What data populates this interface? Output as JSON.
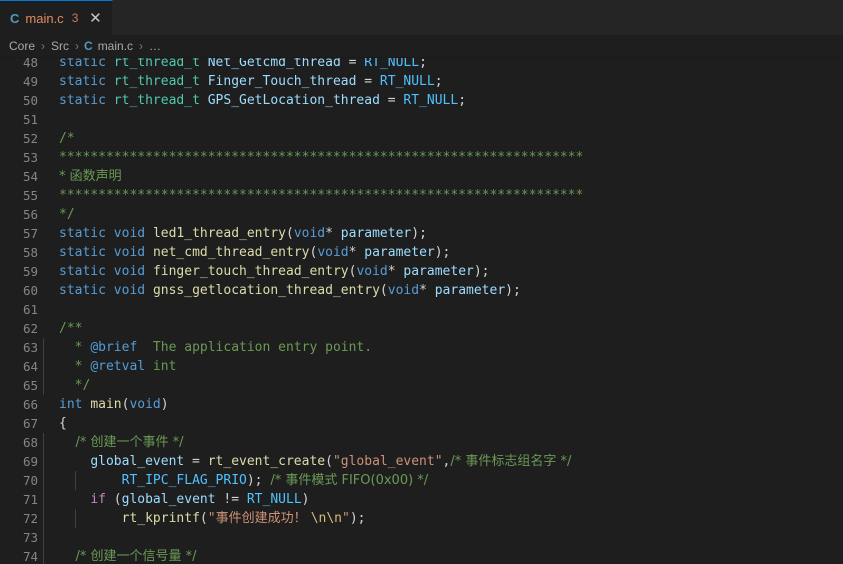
{
  "window": {
    "theme": "dark-plus",
    "background": "#1e1e1e",
    "tabbar_background": "#252526",
    "accent": "#0078d4"
  },
  "tabbar": {
    "tabs": [
      {
        "icon": "c-file-icon",
        "icon_label": "C",
        "label": "main.c",
        "badge": "3",
        "close_label": "✕",
        "active": true
      }
    ]
  },
  "breadcrumb": {
    "items": [
      {
        "label": "Core",
        "icon": null
      },
      {
        "label": "Src",
        "icon": null
      },
      {
        "label": "main.c",
        "icon": "c-file-icon",
        "icon_label": "C"
      },
      {
        "label": "…",
        "icon": null
      }
    ],
    "separator": "›"
  },
  "editor": {
    "language": "c",
    "first_visible_line": 48,
    "last_visible_line": 74,
    "lines": [
      {
        "n": "48",
        "text": "static rt_thread_t Net_Getcmd_thread = RT_NULL;"
      },
      {
        "n": "49",
        "text": "static rt_thread_t Finger_Touch_thread = RT_NULL;"
      },
      {
        "n": "50",
        "text": "static rt_thread_t GPS_GetLocation_thread = RT_NULL;"
      },
      {
        "n": "51",
        "text": ""
      },
      {
        "n": "52",
        "text": "/*"
      },
      {
        "n": "53",
        "text": "*******************************************************************"
      },
      {
        "n": "54",
        "text": "* 函数声明"
      },
      {
        "n": "55",
        "text": "*******************************************************************"
      },
      {
        "n": "56",
        "text": "*/"
      },
      {
        "n": "57",
        "text": "static void led1_thread_entry(void* parameter);"
      },
      {
        "n": "58",
        "text": "static void net_cmd_thread_entry(void* parameter);"
      },
      {
        "n": "59",
        "text": "static void finger_touch_thread_entry(void* parameter);"
      },
      {
        "n": "60",
        "text": "static void gnss_getlocation_thread_entry(void* parameter);"
      },
      {
        "n": "61",
        "text": ""
      },
      {
        "n": "62",
        "text": "/**"
      },
      {
        "n": "63",
        "text": "  * @brief  The application entry point."
      },
      {
        "n": "64",
        "text": "  * @retval int"
      },
      {
        "n": "65",
        "text": "  */"
      },
      {
        "n": "66",
        "text": "int main(void)"
      },
      {
        "n": "67",
        "text": "{"
      },
      {
        "n": "68",
        "text": "    /* 创建一个事件 */"
      },
      {
        "n": "69",
        "text": "    global_event = rt_event_create(\"global_event\",/* 事件标志组名字 */"
      },
      {
        "n": "70",
        "text": "        RT_IPC_FLAG_PRIO); /* 事件模式 FIFO(0x00) */"
      },
      {
        "n": "71",
        "text": "    if (global_event != RT_NULL)"
      },
      {
        "n": "72",
        "text": "        rt_kprintf(\"事件创建成功！ \\n\\n\");"
      },
      {
        "n": "73",
        "text": ""
      },
      {
        "n": "74",
        "text": "    /* 创建一个信号量 */"
      }
    ],
    "tokens": {
      "keyword": "#569cd6",
      "type": "#4ec9b0",
      "variable": "#9cdcfe",
      "function": "#dcdcaa",
      "comment": "#6a9955",
      "string": "#ce9178",
      "escape": "#d7ba7d",
      "constant": "#4fc1ff",
      "control": "#c586c0",
      "plain": "#d4d4d4"
    },
    "line_numbers": {
      "48": "48",
      "49": "49",
      "50": "50",
      "51": "51",
      "52": "52",
      "53": "53",
      "54": "54",
      "55": "55",
      "56": "56",
      "57": "57",
      "58": "58",
      "59": "59",
      "60": "60",
      "61": "61",
      "62": "62",
      "63": "63",
      "64": "64",
      "65": "65",
      "66": "66",
      "67": "67",
      "68": "68",
      "69": "69",
      "70": "70",
      "71": "71",
      "72": "72",
      "73": "73",
      "74": "74"
    },
    "snippets": {
      "l48": {
        "static": "static",
        "type": "rt_thread_t",
        "name": "Net_Getcmd_thread",
        "eq": " = ",
        "val": "RT_NULL",
        "semi": ";"
      },
      "l49": {
        "static": "static",
        "type": "rt_thread_t",
        "name": "Finger_Touch_thread",
        "eq": " = ",
        "val": "RT_NULL",
        "semi": ";"
      },
      "l50": {
        "static": "static",
        "type": "rt_thread_t",
        "name": "GPS_GetLocation_thread",
        "eq": " = ",
        "val": "RT_NULL",
        "semi": ";"
      },
      "l52": "/*",
      "l53": "*******************************************************************",
      "l54": "* 函数声明",
      "l55": "*******************************************************************",
      "l56": "*/",
      "l57": {
        "a": "static",
        "b": " ",
        "c": "void",
        "d": " ",
        "fn": "led1_thread_entry",
        "p1": "(",
        "vtype": "void",
        "star": "* ",
        "param": "parameter",
        "p2": ");"
      },
      "l58": {
        "a": "static",
        "b": " ",
        "c": "void",
        "d": " ",
        "fn": "net_cmd_thread_entry",
        "p1": "(",
        "vtype": "void",
        "star": "* ",
        "param": "parameter",
        "p2": ");"
      },
      "l59": {
        "a": "static",
        "b": " ",
        "c": "void",
        "d": " ",
        "fn": "finger_touch_thread_entry",
        "p1": "(",
        "vtype": "void",
        "star": "* ",
        "param": "parameter",
        "p2": ");"
      },
      "l60": {
        "a": "static",
        "b": " ",
        "c": "void",
        "d": " ",
        "fn": "gnss_getlocation_thread_entry",
        "p1": "(",
        "vtype": "void",
        "star": "* ",
        "param": "parameter",
        "p2": ");"
      },
      "l62": "/**",
      "l63": {
        "star": "  * ",
        "tag": "@brief",
        "text": "  The application entry point."
      },
      "l64": {
        "star": "  * ",
        "tag": "@retval",
        "text": " int"
      },
      "l65": "  */",
      "l66": {
        "int": "int",
        "sp": " ",
        "main": "main",
        "par": "(",
        "void": "void",
        "par2": ")"
      },
      "l67": "{",
      "l68": "    /* 创建一个事件 */",
      "l69": {
        "ind": "    ",
        "var": "global_event",
        "eq": " = ",
        "fn": "rt_event_create",
        "p1": "(",
        "str": "\"global_event\"",
        "comma": ",",
        "cmt": "/* 事件标志组名字 */"
      },
      "l70": {
        "ind": "        ",
        "cst": "RT_IPC_FLAG_PRIO",
        "close": "); ",
        "cmt": "/* 事件模式 FIFO(0x00) */"
      },
      "l71": {
        "ind": "    ",
        "if": "if",
        "sp": " (",
        "var": "global_event",
        "op": " != ",
        "cst": "RT_NULL",
        "close": ")"
      },
      "l72": {
        "ind": "        ",
        "fn": "rt_kprintf",
        "p1": "(",
        "q1": "\"",
        "str": "事件创建成功！ ",
        "esc": "\\n\\n",
        "q2": "\"",
        "close": ");"
      },
      "l74": "    /* 创建一个信号量 */"
    }
  }
}
